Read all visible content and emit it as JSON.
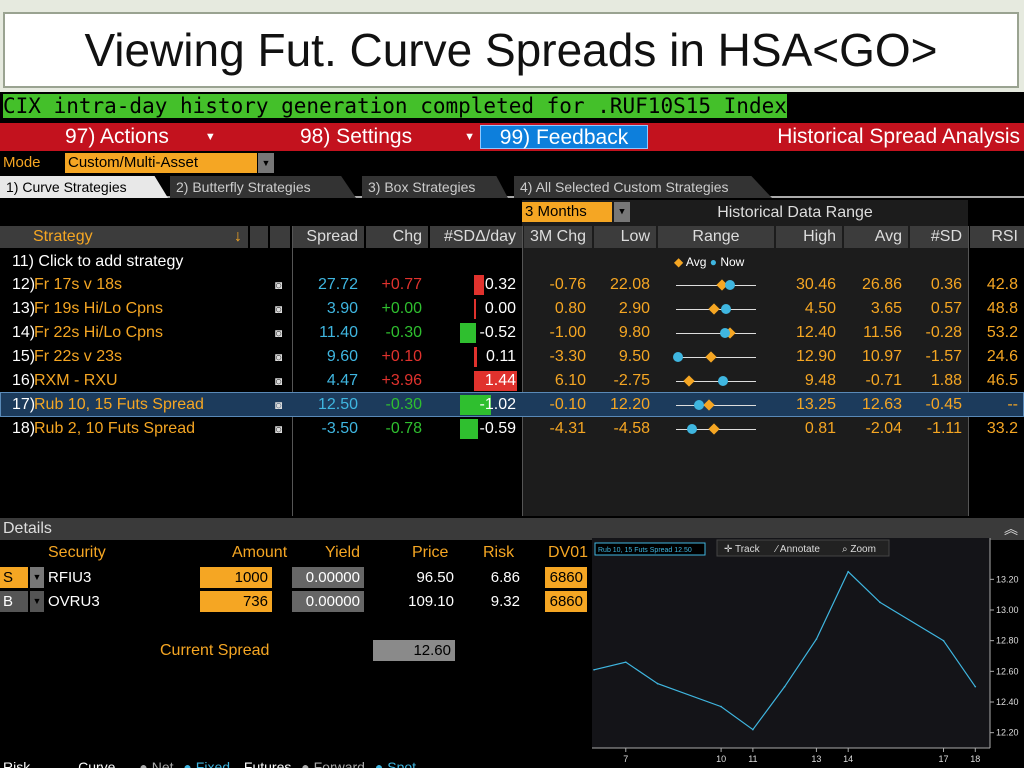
{
  "slide": {
    "title": "Viewing Fut. Curve Spreads in HSA<GO>"
  },
  "status_message": "CIX intra-day history generation completed for .RUF10S15 Index",
  "menu": {
    "actions": "97) Actions",
    "settings": "98) Settings",
    "feedback": "99) Feedback",
    "app_title": "Historical Spread Analysis"
  },
  "mode": {
    "label": "Mode",
    "value": "Custom/Multi-Asset"
  },
  "tabs": [
    {
      "label": "1) Curve Strategies"
    },
    {
      "label": "2) Butterfly Strategies"
    },
    {
      "label": "3) Box Strategies"
    },
    {
      "label": "4) All Selected Custom Strategies"
    }
  ],
  "history": {
    "period": "3 Months",
    "title": "Historical Data Range",
    "legend_avg": "Avg",
    "legend_now": "Now"
  },
  "columns": [
    "Strategy",
    "Spread",
    "Chg",
    "#SDΔ/day",
    "3M Chg",
    "Low",
    "Range",
    "High",
    "Avg",
    "#SD",
    "RSI"
  ],
  "add_row": {
    "num": "11)",
    "label": "Click to add strategy"
  },
  "rows": [
    {
      "num": "12)",
      "name": "Fr 17s v 18s",
      "spread": "27.72",
      "chg": "+0.77",
      "sd": "0.32",
      "chg3m": "-0.76",
      "low": "22.08",
      "high": "30.46",
      "avg": "26.86",
      "nsd": "0.36",
      "rsi": "42.8",
      "bar": 0.32,
      "low_v": 22.08,
      "high_v": 30.46,
      "avg_v": 26.86,
      "now_v": 27.72
    },
    {
      "num": "13)",
      "name": "Fr 19s Hi/Lo Cpns",
      "spread": "3.90",
      "chg": "+0.00",
      "sd": "0.00",
      "chg3m": "0.80",
      "low": "2.90",
      "high": "4.50",
      "avg": "3.65",
      "nsd": "0.57",
      "rsi": "48.8",
      "bar": 0.0,
      "low_v": 2.9,
      "high_v": 4.5,
      "avg_v": 3.65,
      "now_v": 3.9
    },
    {
      "num": "14)",
      "name": "Fr 22s Hi/Lo Cpns",
      "spread": "11.40",
      "chg": "-0.30",
      "sd": "-0.52",
      "chg3m": "-1.00",
      "low": "9.80",
      "high": "12.40",
      "avg": "11.56",
      "nsd": "-0.28",
      "rsi": "53.2",
      "bar": -0.52,
      "low_v": 9.8,
      "high_v": 12.4,
      "avg_v": 11.56,
      "now_v": 11.4
    },
    {
      "num": "15)",
      "name": "Fr 22s v 23s",
      "spread": "9.60",
      "chg": "+0.10",
      "sd": "0.11",
      "chg3m": "-3.30",
      "low": "9.50",
      "high": "12.90",
      "avg": "10.97",
      "nsd": "-1.57",
      "rsi": "24.6",
      "bar": 0.11,
      "low_v": 9.5,
      "high_v": 12.9,
      "avg_v": 10.97,
      "now_v": 9.6
    },
    {
      "num": "16)",
      "name": "RXM - RXU",
      "spread": "4.47",
      "chg": "+3.96",
      "sd": "1.44",
      "chg3m": "6.10",
      "low": "-2.75",
      "high": "9.48",
      "avg": "-0.71",
      "nsd": "1.88",
      "rsi": "46.5",
      "bar": 1.44,
      "low_v": -2.75,
      "high_v": 9.48,
      "avg_v": -0.71,
      "now_v": 4.47
    },
    {
      "num": "17)",
      "name": "Rub 10, 15 Futs Spread",
      "spread": "12.50",
      "chg": "-0.30",
      "sd": "-1.02",
      "chg3m": "-0.10",
      "low": "12.20",
      "high": "13.25",
      "avg": "12.63",
      "nsd": "-0.45",
      "rsi": "--",
      "bar": -1.02,
      "low_v": 12.2,
      "high_v": 13.25,
      "avg_v": 12.63,
      "now_v": 12.5,
      "selected": true
    },
    {
      "num": "18)",
      "name": "Rub 2, 10 Futs Spread",
      "spread": "-3.50",
      "chg": "-0.78",
      "sd": "-0.59",
      "chg3m": "-4.31",
      "low": "-4.58",
      "high": "0.81",
      "avg": "-2.04",
      "nsd": "-1.11",
      "rsi": "33.2",
      "bar": -0.59,
      "low_v": -4.58,
      "high_v": 0.81,
      "avg_v": -2.04,
      "now_v": -3.5
    }
  ],
  "details": {
    "title": "Details",
    "headers": {
      "security": "Security",
      "amount": "Amount",
      "yield": "Yield",
      "price": "Price",
      "risk": "Risk",
      "dv01": "DV01"
    },
    "legs": [
      {
        "side": "S",
        "security": "RFIU3",
        "amount": "1000",
        "yield": "0.00000",
        "price": "96.50",
        "risk": "6.86",
        "dv01": "6860"
      },
      {
        "side": "B",
        "security": "OVRU3",
        "amount": "736",
        "yield": "0.00000",
        "price": "109.10",
        "risk": "9.32",
        "dv01": "6860"
      }
    ],
    "current_spread_label": "Current Spread",
    "current_spread": "12.60",
    "bottom_labels": [
      "Risk",
      "Curve",
      "Net",
      "Fixed",
      "Futures",
      "Forward",
      "Spot"
    ]
  },
  "chart_toolbar": {
    "series_tag": "Rub 10, 15 Futs Spread  12.50",
    "track": "Track",
    "annotate": "Annotate",
    "zoom": "Zoom"
  },
  "chart_data": {
    "type": "line",
    "x": [
      6,
      7,
      8,
      10,
      11,
      12,
      13,
      14,
      15,
      17,
      18
    ],
    "values": [
      12.61,
      12.66,
      12.52,
      12.37,
      12.22,
      12.5,
      12.81,
      13.25,
      13.05,
      12.8,
      12.5
    ],
    "x_ticks": [
      "7",
      "10",
      "11",
      "13",
      "14",
      "17",
      "18"
    ],
    "y_ticks": [
      "13.20",
      "13.00",
      "12.80",
      "12.60",
      "12.40",
      "12.20"
    ],
    "ylim": [
      12.1,
      13.3
    ],
    "color": "#3fb6e0"
  },
  "colors": {
    "orange": "#f5a623",
    "blue": "#3fb6e0",
    "green": "#2fbf2f",
    "red": "#e0322d",
    "menu_red": "#c3121e"
  }
}
